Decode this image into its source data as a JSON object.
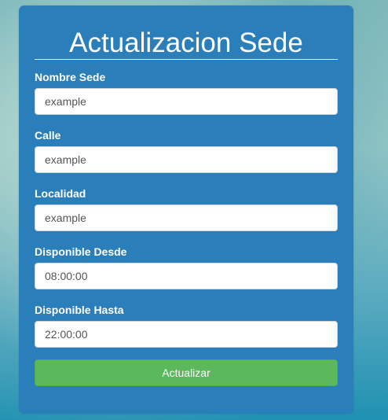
{
  "form": {
    "title": "Actualizacion Sede",
    "fields": [
      {
        "label": "Nombre Sede",
        "placeholder": "example",
        "value": ""
      },
      {
        "label": "Calle",
        "placeholder": "example",
        "value": ""
      },
      {
        "label": "Localidad",
        "placeholder": "example",
        "value": ""
      },
      {
        "label": "Disponible Desde",
        "placeholder": "",
        "value": "08:00:00"
      },
      {
        "label": "Disponible Hasta",
        "placeholder": "",
        "value": "22:00:00"
      }
    ],
    "submit_label": "Actualizar"
  },
  "colors": {
    "card_background": "#2a7fba",
    "button_success": "#5cb85c",
    "text_on_card": "#ffffff"
  }
}
